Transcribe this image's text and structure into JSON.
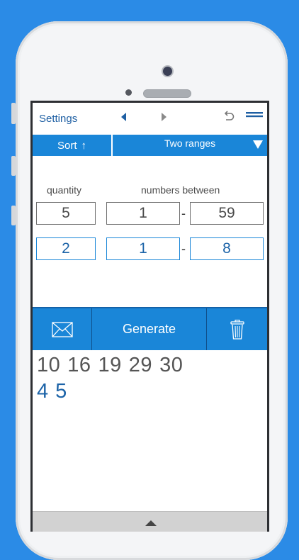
{
  "topbar": {
    "settings_label": "Settings",
    "icons": [
      "triangle-left-icon",
      "triangle-right-icon",
      "undo-icon",
      "menu-icon"
    ]
  },
  "modebar": {
    "sort_label": "Sort",
    "sort_arrow": "↑",
    "range_label": "Two ranges"
  },
  "labels": {
    "quantity": "quantity",
    "numbers_between": "numbers between"
  },
  "range1": {
    "quantity": "5",
    "from": "1",
    "separator": "-",
    "to": "59"
  },
  "range2": {
    "quantity": "2",
    "from": "1",
    "separator": "-",
    "to": "8"
  },
  "actions": {
    "generate_label": "Generate",
    "icons": [
      "mail-icon",
      "trash-icon"
    ]
  },
  "results": {
    "row1": [
      "10",
      "16",
      "19",
      "29",
      "30"
    ],
    "row2": [
      "4",
      "5"
    ]
  },
  "colors": {
    "background": "#2b8be6",
    "accent": "#1a86d8",
    "link": "#1e5fa3",
    "second_range_text": "#1d64a8"
  }
}
